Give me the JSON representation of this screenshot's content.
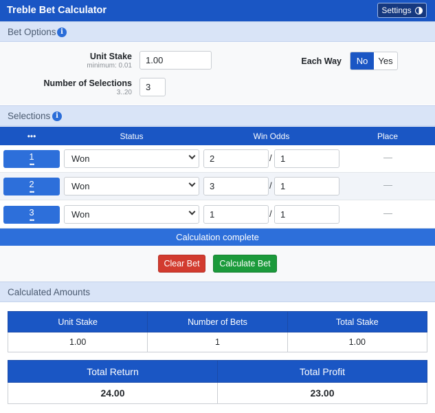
{
  "app": {
    "title": "Treble Bet Calculator",
    "settings_label": "Settings"
  },
  "bet_options": {
    "header": "Bet Options",
    "unit_stake_label": "Unit Stake",
    "unit_stake_hint": "minimum: 0.01",
    "unit_stake_value": "1.00",
    "selections_label": "Number of Selections",
    "selections_hint": "3..20",
    "selections_value": "3",
    "each_way_label": "Each Way",
    "each_way_no": "No",
    "each_way_yes": "Yes",
    "each_way_selected": "No"
  },
  "selections": {
    "header": "Selections",
    "columns": {
      "menu": "•••",
      "status": "Status",
      "win_odds": "Win Odds",
      "place": "Place"
    },
    "rows": [
      {
        "num": "1",
        "dots": "•••",
        "status": "Won",
        "odds_num": "2",
        "odds_den": "1",
        "sep": "/",
        "place": "—"
      },
      {
        "num": "2",
        "dots": "•••",
        "status": "Won",
        "odds_num": "3",
        "odds_den": "1",
        "sep": "/",
        "place": "—"
      },
      {
        "num": "3",
        "dots": "•••",
        "status": "Won",
        "odds_num": "1",
        "odds_den": "1",
        "sep": "/",
        "place": "—"
      }
    ]
  },
  "status_message": "Calculation complete",
  "actions": {
    "clear": "Clear Bet",
    "calculate": "Calculate Bet"
  },
  "calculated": {
    "header": "Calculated Amounts",
    "table1": {
      "headers": [
        "Unit Stake",
        "Number of Bets",
        "Total Stake"
      ],
      "values": [
        "1.00",
        "1",
        "1.00"
      ]
    },
    "table2": {
      "headers": [
        "Total Return",
        "Total Profit"
      ],
      "values": [
        "24.00",
        "23.00"
      ]
    }
  },
  "colors": {
    "primary": "#1a56c4",
    "header_band": "#d9e4f7",
    "danger": "#d23b2f",
    "success": "#1b9a3b"
  }
}
